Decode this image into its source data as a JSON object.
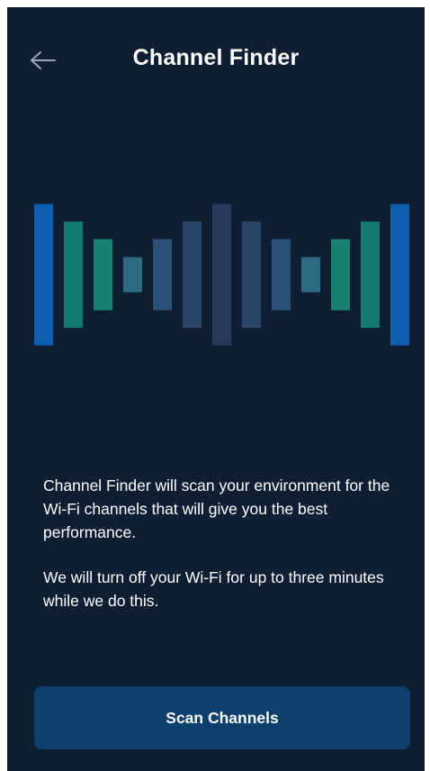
{
  "header": {
    "title": "Channel Finder",
    "back_icon": "arrow-left-icon"
  },
  "illustration": {
    "icon": "signal-bars-icon",
    "bars": [
      {
        "level": 1.0,
        "color": "#0f5fb0"
      },
      {
        "level": 0.75,
        "color": "#137a6e"
      },
      {
        "level": 0.5,
        "color": "#17806e"
      },
      {
        "level": 0.25,
        "color": "#2e6a82"
      },
      {
        "level": 0.5,
        "color": "#2a5075"
      },
      {
        "level": 0.75,
        "color": "#2a4568"
      },
      {
        "level": 1.0,
        "color": "#273a5c"
      },
      {
        "level": 0.75,
        "color": "#2a4568"
      },
      {
        "level": 0.5,
        "color": "#2a5075"
      },
      {
        "level": 0.25,
        "color": "#2e6a82"
      },
      {
        "level": 0.5,
        "color": "#17806e"
      },
      {
        "level": 0.75,
        "color": "#137a6e"
      },
      {
        "level": 1.0,
        "color": "#0f5fb0"
      }
    ]
  },
  "description": {
    "paragraph1": "Channel Finder will scan your environment for the Wi-Fi channels that will give you the best performance.",
    "paragraph2": "We will turn off your Wi-Fi for up to three minutes while we do this."
  },
  "actions": {
    "scan_label": "Scan Channels"
  },
  "colors": {
    "background": "#0f1f33",
    "button": "#0c3f6b",
    "text": "#ffffff"
  }
}
